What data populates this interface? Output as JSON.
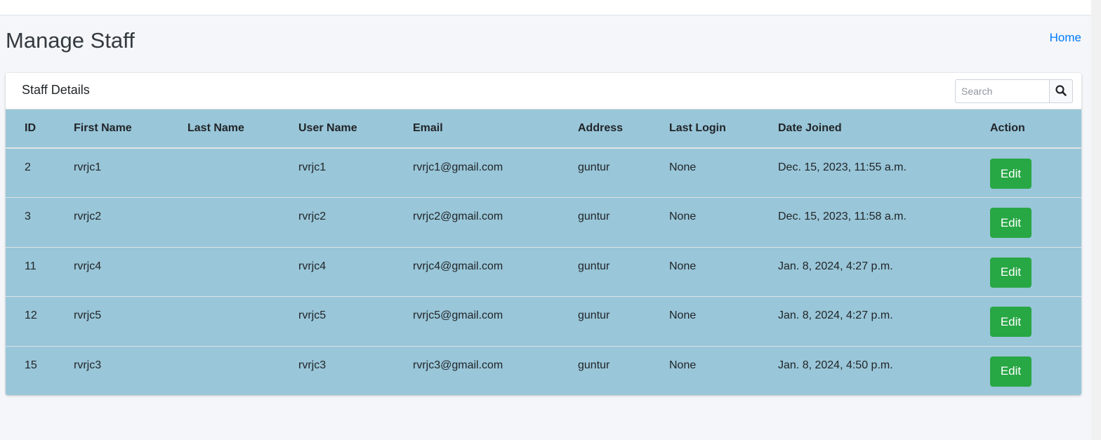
{
  "page": {
    "title": "Manage Staff",
    "breadcrumb_home": "Home"
  },
  "card": {
    "title": "Staff Details",
    "search_placeholder": "Search",
    "search_icon": "search-icon"
  },
  "table": {
    "columns": [
      "ID",
      "First Name",
      "Last Name",
      "User Name",
      "Email",
      "Address",
      "Last Login",
      "Date Joined",
      "Action"
    ],
    "rows": [
      {
        "id": "2",
        "first_name": "rvrjc1",
        "last_name": "",
        "username": "rvrjc1",
        "email": "rvrjc1@gmail.com",
        "address": "guntur",
        "last_login": "None",
        "date_joined": "Dec. 15, 2023, 11:55 a.m.",
        "action": "Edit"
      },
      {
        "id": "3",
        "first_name": "rvrjc2",
        "last_name": "",
        "username": "rvrjc2",
        "email": "rvrjc2@gmail.com",
        "address": "guntur",
        "last_login": "None",
        "date_joined": "Dec. 15, 2023, 11:58 a.m.",
        "action": "Edit"
      },
      {
        "id": "11",
        "first_name": "rvrjc4",
        "last_name": "",
        "username": "rvrjc4",
        "email": "rvrjc4@gmail.com",
        "address": "guntur",
        "last_login": "None",
        "date_joined": "Jan. 8, 2024, 4:27 p.m.",
        "action": "Edit"
      },
      {
        "id": "12",
        "first_name": "rvrjc5",
        "last_name": "",
        "username": "rvrjc5",
        "email": "rvrjc5@gmail.com",
        "address": "guntur",
        "last_login": "None",
        "date_joined": "Jan. 8, 2024, 4:27 p.m.",
        "action": "Edit"
      },
      {
        "id": "15",
        "first_name": "rvrjc3",
        "last_name": "",
        "username": "rvrjc3",
        "email": "rvrjc3@gmail.com",
        "address": "guntur",
        "last_login": "None",
        "date_joined": "Jan. 8, 2024, 4:50 p.m.",
        "action": "Edit"
      }
    ]
  },
  "colors": {
    "table_bg": "#99c6d8",
    "edit_button": "#28a745",
    "link": "#007bff"
  }
}
